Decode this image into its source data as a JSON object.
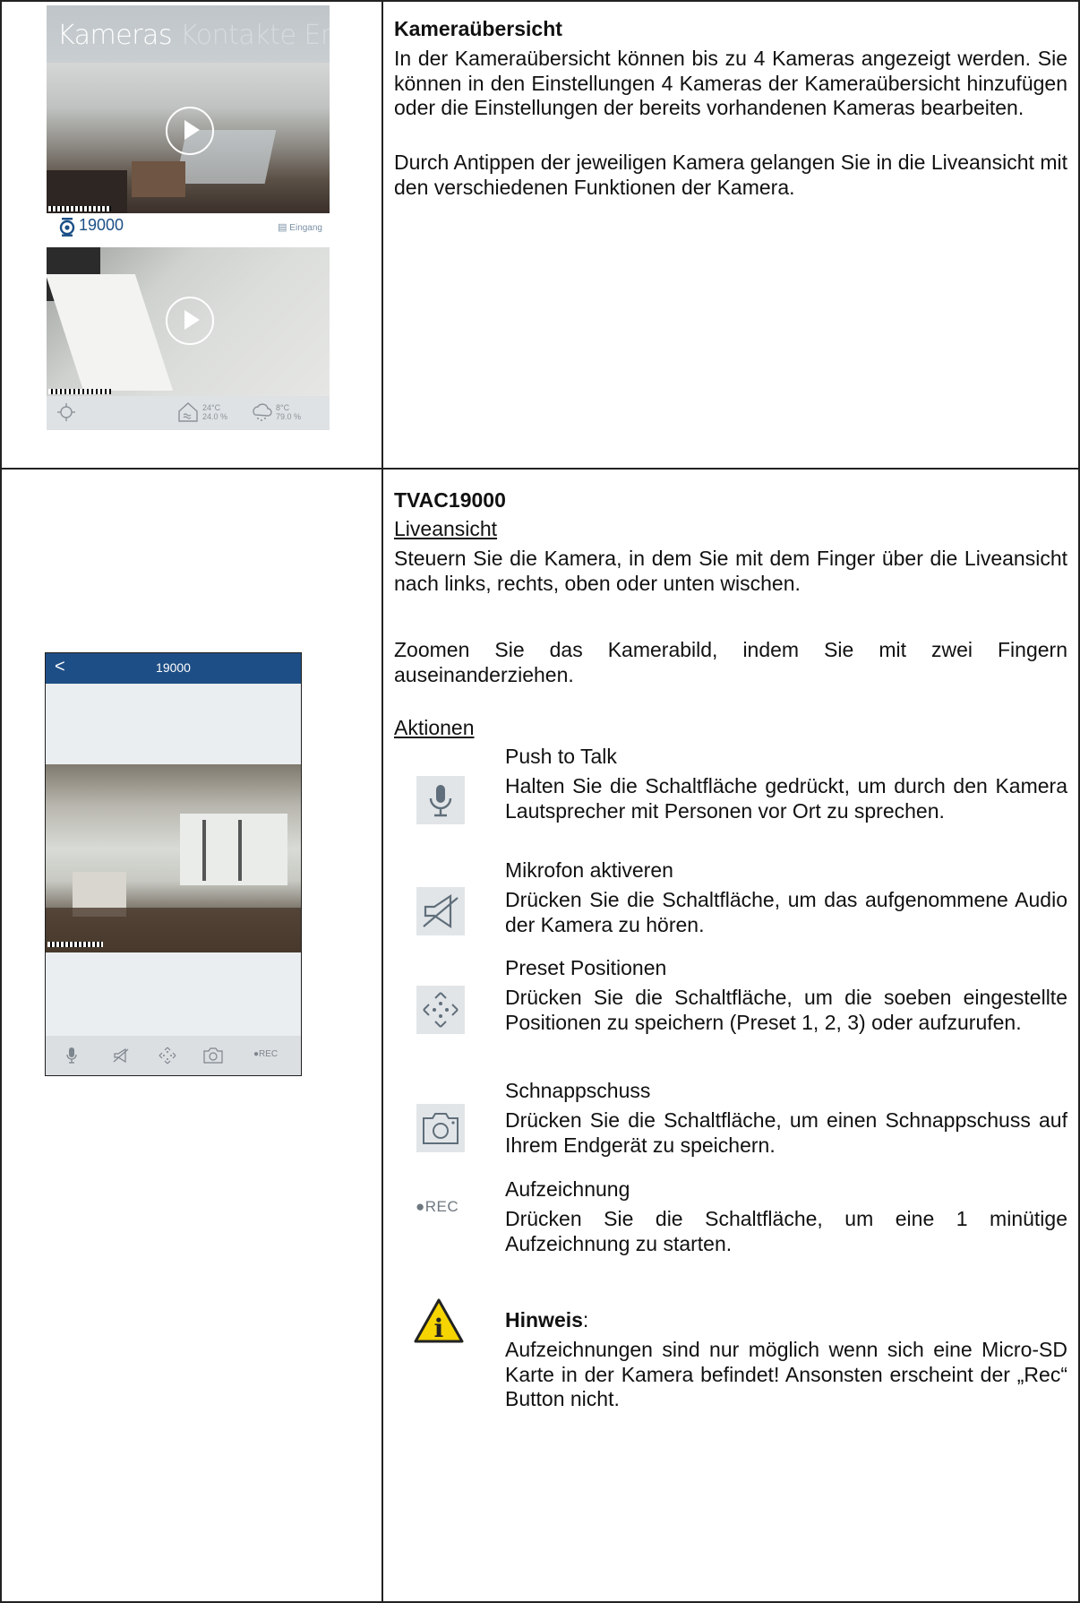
{
  "row1": {
    "phone": {
      "tab_active": "Kameras",
      "tab_inactive": "Kontakte Ereig",
      "camera_name": "19000",
      "location_label": "Eingang",
      "indoor_temp": "24°C",
      "indoor_humidity": "24.0 %",
      "outdoor_temp": "8°C",
      "outdoor_humidity": "79.0 %"
    },
    "heading": "Kameraübersicht",
    "paragraphs": [
      "In der Kameraübersicht können bis zu 4 Kameras angezeigt werden. Sie können in den Einstellungen 4 Kameras der Kameraübersicht hinzufügen oder die Einstellungen der bereits vorhandenen Kameras bearbeiten.",
      "Durch Antippen der jeweiligen Kamera gelangen Sie in die Liveansicht mit den verschiedenen Funktionen der Kamera."
    ]
  },
  "row2": {
    "phone": {
      "back": "<",
      "title": "19000",
      "footer_rec": "●REC"
    },
    "heading": "TVAC19000",
    "liveansicht_title": "Liveansicht",
    "liveansicht_p1": "Steuern Sie die Kamera, in dem Sie mit dem Finger über die Liveansicht nach links, rechts, oben oder unten wischen.",
    "liveansicht_p2": "Zoomen Sie das Kamerabild, indem Sie mit zwei Fingern auseinanderziehen.",
    "aktionen_title": "Aktionen",
    "actions": [
      {
        "icon": "microphone-icon",
        "title": "Push to Talk",
        "desc": "Halten Sie die Schaltfläche gedrückt, um durch den Kamera Lautsprecher mit Personen vor Ort zu sprechen."
      },
      {
        "icon": "speaker-muted-icon",
        "title": "Mikrofon aktiveren",
        "desc": "Drücken Sie die Schaltfläche, um das aufgenommene Audio der Kamera zu hören."
      },
      {
        "icon": "move-arrows-icon",
        "title": "Preset Positionen",
        "desc": "Drücken Sie die Schaltfläche, um die soeben eingestellte Positionen zu speichern (Preset 1, 2, 3) oder aufzurufen."
      },
      {
        "icon": "camera-snapshot-icon",
        "title": "Schnappschuss",
        "desc": "Drücken Sie die Schaltfläche, um einen Schnappschuss auf Ihrem Endgerät zu speichern."
      },
      {
        "icon": "rec-icon",
        "icon_label": "●REC",
        "title": "Aufzeichnung",
        "desc": "Drücken Sie die Schaltfläche, um eine 1 minütige Aufzeichnung zu starten."
      }
    ],
    "note_title": "Hinweis",
    "note_colon": ":",
    "note_text": "Aufzeichnungen sind nur möglich wenn sich eine Micro-SD Karte in der Kamera befindet! Ansonsten erscheint der „Rec“ Button nicht."
  }
}
